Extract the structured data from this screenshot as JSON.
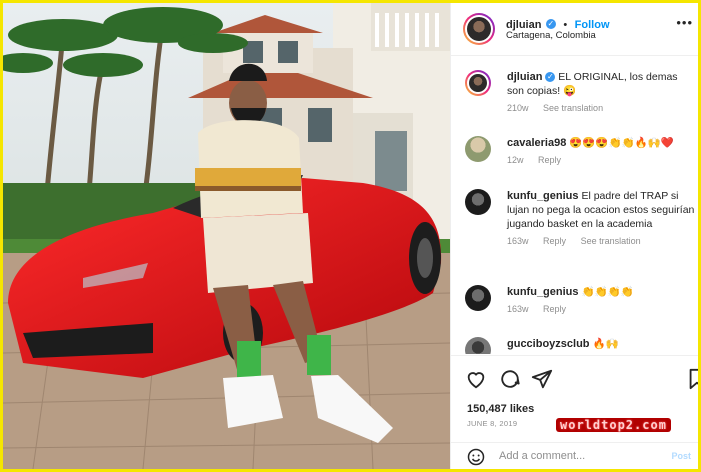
{
  "header": {
    "username": "djluian",
    "verified_symbol": "✓",
    "follow_label": "Follow",
    "separator": "•",
    "location": "Cartagena, Colombia",
    "more_symbol": "•••"
  },
  "caption": {
    "username": "djluian",
    "text": "EL ORIGINAL, los demas son copias! 😜",
    "time": "210w",
    "translate": "See translation"
  },
  "comments": [
    {
      "username": "cavaleria98",
      "text": "😍😍😍👏👏🔥🙌❤️",
      "time": "12w",
      "reply": "Reply",
      "translate": ""
    },
    {
      "username": "kunfu_genius",
      "text": "El padre del TRAP si lujan no pega la ocacion estos seguirían jugando basket en la academia",
      "time": "163w",
      "reply": "Reply",
      "translate": "See translation"
    },
    {
      "username": "kunfu_genius",
      "text": "👏👏👏👏",
      "time": "163w",
      "reply": "Reply",
      "translate": ""
    },
    {
      "username": "gucciboyzsclub",
      "text": "🔥🙌",
      "time": "",
      "reply": "",
      "translate": ""
    }
  ],
  "post": {
    "likes": "150,487 likes",
    "date": "JUNE 8, 2019"
  },
  "add_comment": {
    "placeholder": "Add a comment...",
    "post_label": "Post"
  },
  "watermark": "worldtop2.com",
  "colors": {
    "frame": "#f5e600",
    "link_blue": "#0095f6",
    "car_red": "#e3131b"
  },
  "icons": [
    "heart-icon",
    "comment-icon",
    "share-icon",
    "bookmark-icon",
    "emoji-icon",
    "verified-icon",
    "more-options-icon"
  ]
}
